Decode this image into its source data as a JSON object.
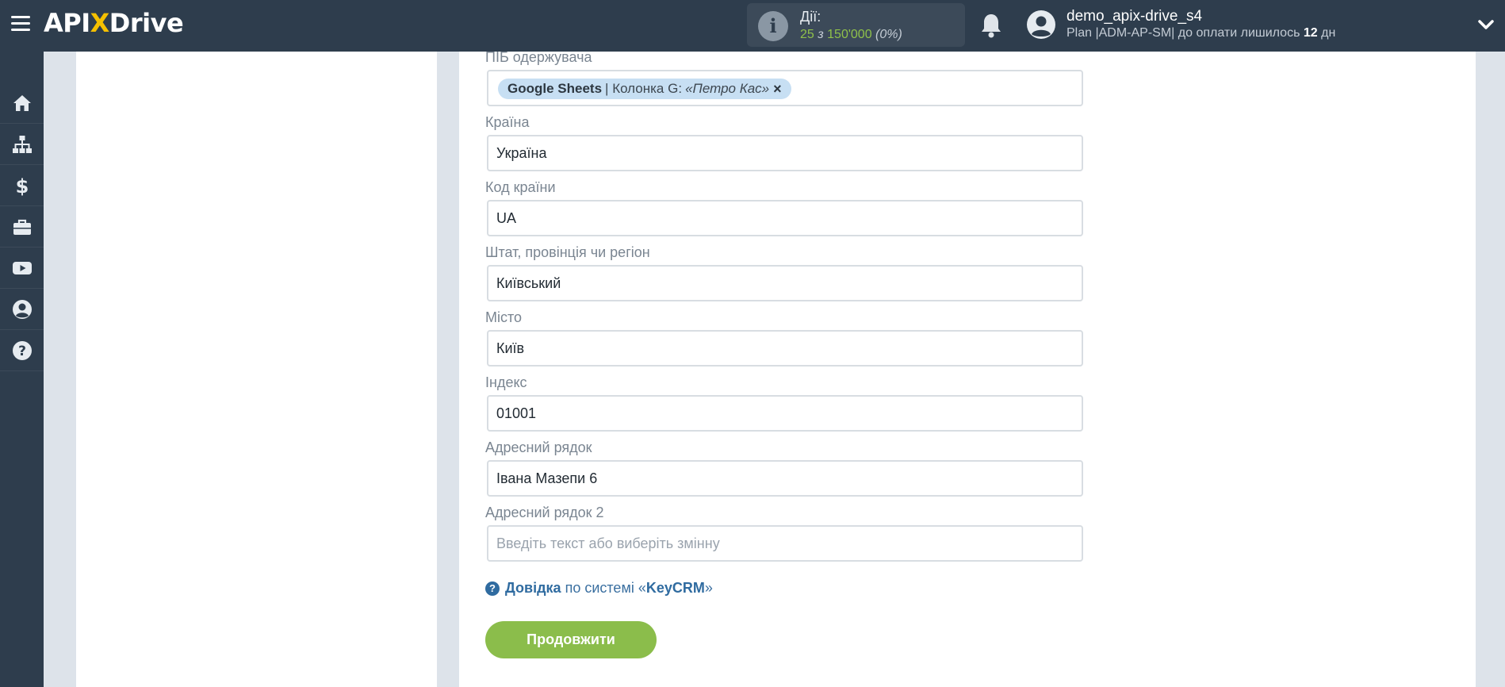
{
  "header": {
    "logo": {
      "pre": "API",
      "x": "X",
      "post": "Drive"
    },
    "actions": {
      "label": "Дії:",
      "used": "25",
      "of": "з",
      "total": "150'000",
      "percent": "(0%)"
    },
    "user": {
      "name": "demo_apix-drive_s4",
      "plan_text": "Plan |ADM-AP-SM| до оплати лишилось",
      "days": "12",
      "days_unit": "дн"
    }
  },
  "sidebar": {
    "items": [
      {
        "icon": "home-icon"
      },
      {
        "icon": "sitemap-icon"
      },
      {
        "icon": "dollar-icon"
      },
      {
        "icon": "briefcase-icon"
      },
      {
        "icon": "youtube-icon"
      },
      {
        "icon": "user-circle-icon"
      },
      {
        "icon": "help-circle-icon"
      }
    ]
  },
  "form": {
    "recipient": {
      "label": "ПІБ одержувача",
      "tag_source": "Google Sheets",
      "tag_sep": "|",
      "tag_column": "Колонка G:",
      "tag_value": "«Петро Кас»",
      "tag_remove": "×"
    },
    "fields": [
      {
        "key": "country",
        "label": "Країна",
        "value": "Україна",
        "placeholder": ""
      },
      {
        "key": "country_code",
        "label": "Код країни",
        "value": "UA",
        "placeholder": ""
      },
      {
        "key": "state",
        "label": "Штат, провінція чи регіон",
        "value": "Київський",
        "placeholder": ""
      },
      {
        "key": "city",
        "label": "Місто",
        "value": "Київ",
        "placeholder": ""
      },
      {
        "key": "zip",
        "label": "Індекс",
        "value": "01001",
        "placeholder": ""
      },
      {
        "key": "address1",
        "label": "Адресний рядок",
        "value": "Івана Мазепи 6",
        "placeholder": ""
      },
      {
        "key": "address2",
        "label": "Адресний рядок 2",
        "value": "",
        "placeholder": "Введіть текст або виберіть змінну"
      }
    ],
    "help": {
      "link": "Довідка",
      "middle": "по системі «",
      "system": "KeyCRM",
      "end": "»"
    },
    "continue_label": "Продовжити"
  },
  "colors": {
    "topbar": "#2e3d4d",
    "accent_green": "#8bbd4b",
    "link_blue": "#2f6ba0",
    "tag_bg": "#c7dff3"
  }
}
